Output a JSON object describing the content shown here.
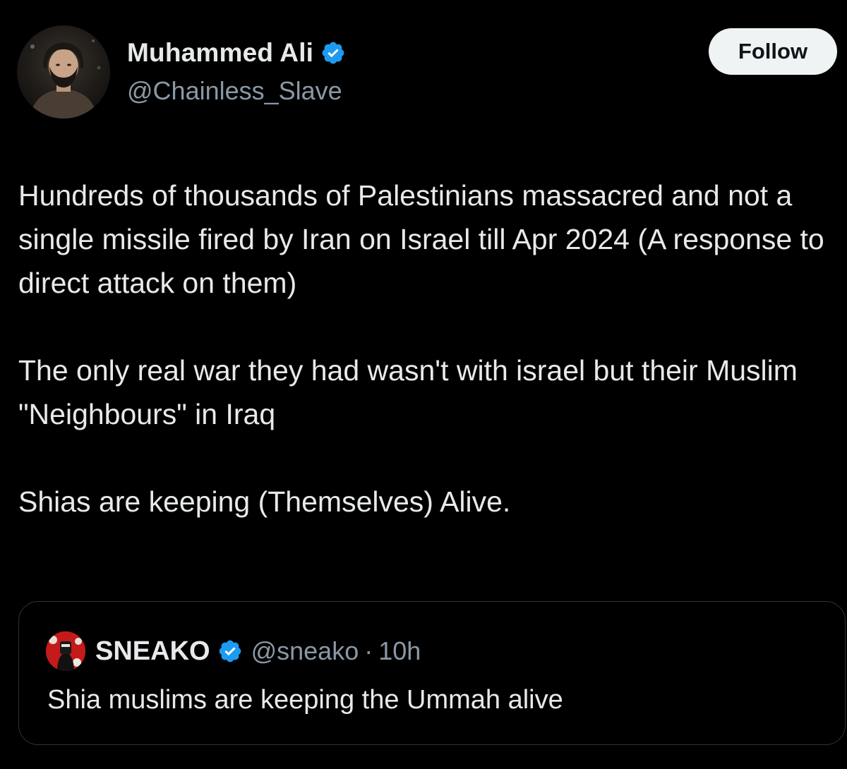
{
  "author": {
    "display_name": "Muhammed Ali",
    "handle": "@Chainless_Slave",
    "verified_icon": "verified-badge-icon",
    "avatar_icon": "profile-photo"
  },
  "follow_button": {
    "label": "Follow"
  },
  "tweet": {
    "paragraphs": [
      "Hundreds of thousands of Palestinians massacred and not a single missile fired by Iran on Israel till Apr 2024 (A response to direct attack on them)",
      "The only real war they had wasn't with israel but their Muslim \"Neighbours\" in Iraq",
      "Shias are keeping (Themselves) Alive."
    ]
  },
  "quoted_tweet": {
    "display_name": "SNEAKO",
    "handle": "@sneako",
    "separator": "·",
    "time": "10h",
    "text": "Shia muslims are keeping the Ummah alive"
  },
  "colors": {
    "background": "#000000",
    "primary_text": "#e7e9ea",
    "secondary_text": "#8b98a5",
    "verified_blue": "#1d9bf0",
    "follow_button_bg": "#eff3f4",
    "border": "#2f3336"
  }
}
